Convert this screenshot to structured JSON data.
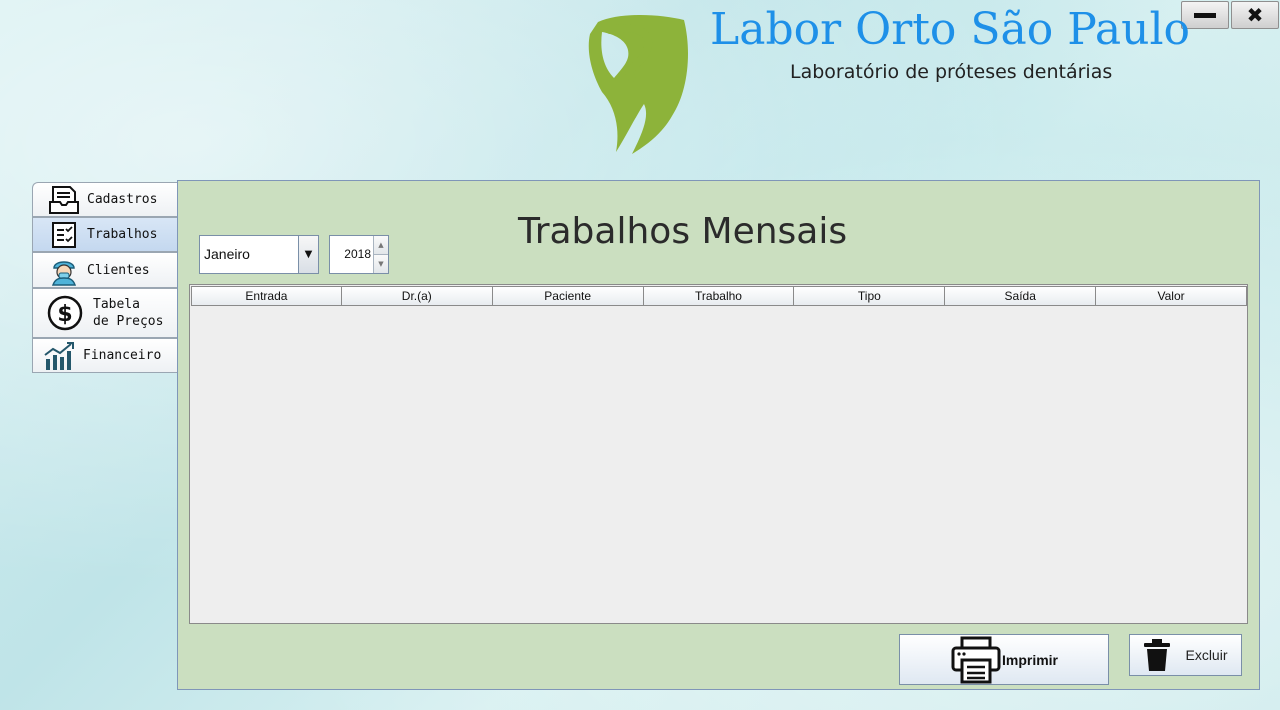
{
  "header": {
    "title": "Labor Orto São Paulo",
    "subtitle": "Laboratório de próteses dentárias",
    "logo_icon": "tooth-logo-icon",
    "logo_color": "#8db33a",
    "title_color": "#1e90e8"
  },
  "window_controls": {
    "minimize_icon": "minimize-icon",
    "close_icon": "close-icon",
    "close_glyph": "✖"
  },
  "sidebar": {
    "items": [
      {
        "label": "Cadastros",
        "icon": "document-icon",
        "selected": false
      },
      {
        "label": "Trabalhos",
        "icon": "checklist-icon",
        "selected": true
      },
      {
        "label": "Clientes",
        "icon": "dentist-icon",
        "selected": false
      },
      {
        "label_line1": "Tabela",
        "label_line2": "de Preços",
        "icon": "dollar-icon",
        "selected": false
      },
      {
        "label": "Financeiro",
        "icon": "chart-icon",
        "selected": false
      }
    ]
  },
  "main": {
    "title": "Trabalhos Mensais",
    "month_select": {
      "value": "Janeiro"
    },
    "year_spinner": {
      "value": "2018"
    },
    "table": {
      "columns": [
        "Entrada",
        "Dr.(a)",
        "Paciente",
        "Trabalho",
        "Tipo",
        "Saída",
        "Valor"
      ],
      "rows": []
    },
    "buttons": {
      "print_label": "Imprimir",
      "print_icon": "printer-icon",
      "delete_label": "Excluir",
      "delete_icon": "trash-icon"
    },
    "panel_color": "#cbdfc0"
  }
}
